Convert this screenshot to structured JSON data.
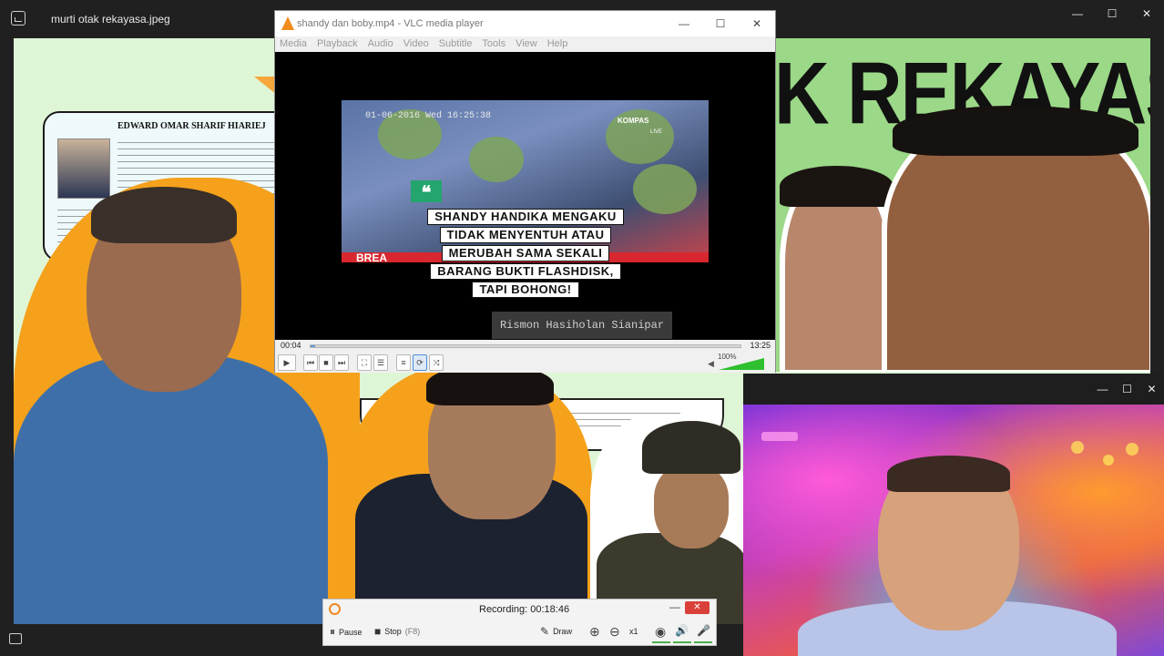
{
  "viewer": {
    "title": "murti otak rekayasa.jpeg",
    "controls": {
      "minimize": "—",
      "maximize": "☐",
      "close": "✕"
    }
  },
  "collage": {
    "card_name": "EDWARD OMAR SHARIF HIARIEJ",
    "banner_text": "K REKAYASA"
  },
  "vlc": {
    "title": "shandy dan boby.mp4 - VLC media player",
    "controls": {
      "minimize": "—",
      "maximize": "☐",
      "close": "✕"
    },
    "menu": [
      "Media",
      "Playback",
      "Audio",
      "Video",
      "Subtitle",
      "Tools",
      "View",
      "Help"
    ],
    "video": {
      "timestamp": "01-06-2016 Wed 16:25:38",
      "channel_logo": "KOMPAS",
      "channel_sub": "LIVE",
      "quote_mark": "❝",
      "ticker": "BREA",
      "caption_lines": [
        "SHANDY HANDIKA MENGAKU",
        "TIDAK MENYENTUH ATAU",
        "MERUBAH SAMA SEKALI",
        "BARANG BUKTI FLASHDISK,",
        "TAPI BOHONG!"
      ],
      "watermark": "Rismon Hasiholan Sianipar"
    },
    "time_elapsed": "00:04",
    "time_total": "13:25",
    "progress": 0.005,
    "volume_label": "100%",
    "volume": 1.0,
    "buttons": {
      "play": "▶",
      "prev": "⏮",
      "stop": "■",
      "next": "⏭",
      "fullscreen": "⛶",
      "extended": "☰",
      "playlist": "≡",
      "loop": "⟳",
      "shuffle": "⤨"
    }
  },
  "webcam": {
    "controls": {
      "minimize": "—",
      "maximize": "☐",
      "close": "✕"
    }
  },
  "recorder": {
    "status": "Recording:  00:18:46",
    "minimize": "—",
    "close": "✕",
    "pause_label": "Pause",
    "stop_label": "Stop",
    "stop_hint": "(F8)",
    "draw_label": "Draw",
    "zoom_label": "x1",
    "icons": {
      "pause": "⏸",
      "stop": "■",
      "draw": "✎",
      "zoom_in": "⊕",
      "zoom_out": "⊖",
      "webcam": "◉",
      "speaker": "🔊",
      "mic": "🎤"
    }
  },
  "colors": {
    "vlc_accent": "#f28c1c",
    "volume_fill": "#2ec02e",
    "recorder_accent": "#f08a24",
    "close_red": "#d9403a"
  }
}
